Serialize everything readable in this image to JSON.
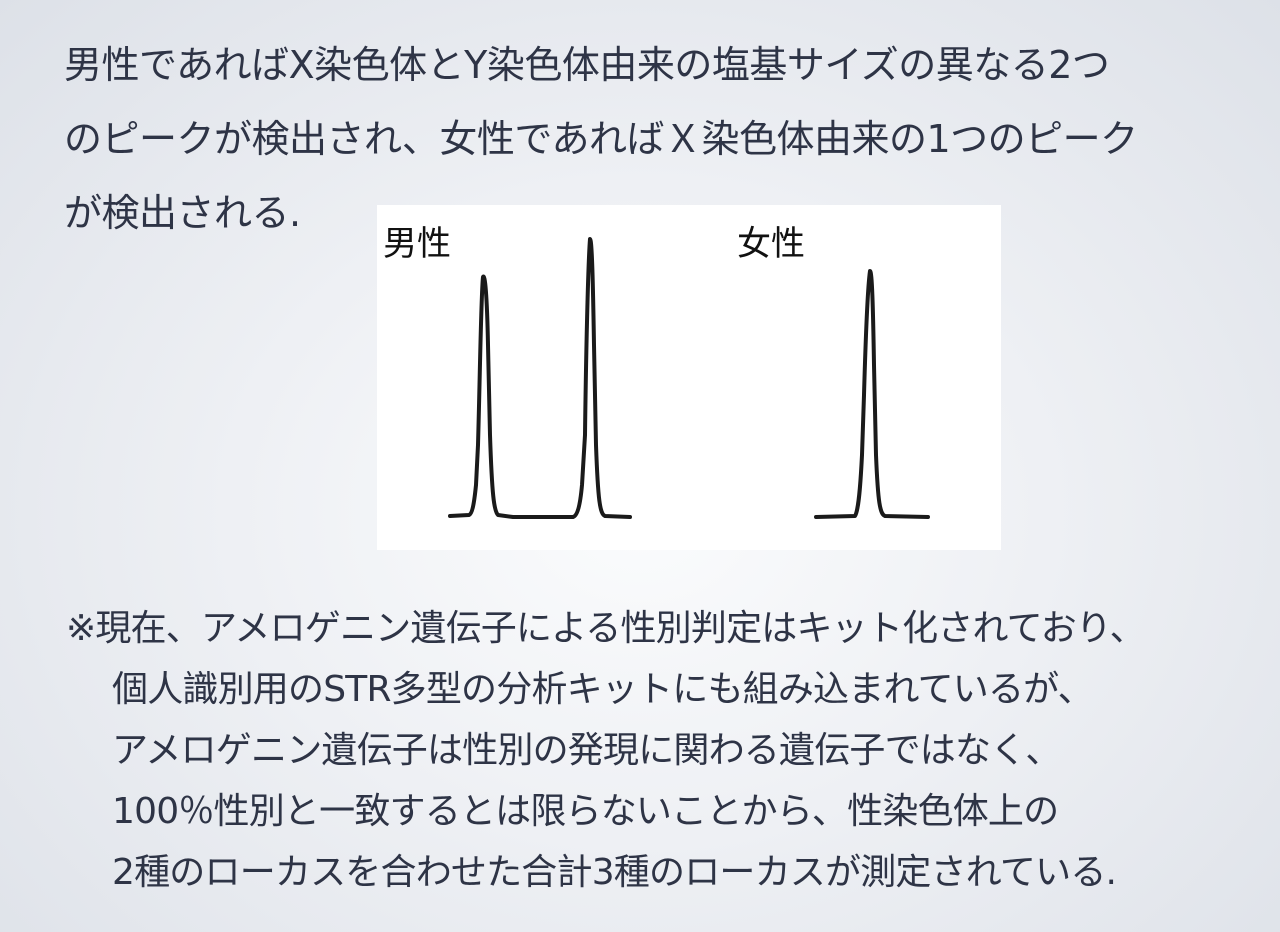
{
  "intro": {
    "lines": [
      "男性であればX染色体とY染色体由来の塩基サイズの異なる2つ",
      "のピークが検出され、女性であればＸ染色体由来の1つのピーク",
      "が検出される."
    ]
  },
  "figure": {
    "male_label": "男性",
    "female_label": "女性",
    "male_peak_count": 2,
    "female_peak_count": 1
  },
  "note": {
    "lines": [
      "※現在、アメロゲニン遺伝子による性別判定はキット化されており、",
      "個人識別用のSTR多型の分析キットにも組み込まれているが、",
      "アメロゲニン遺伝子は性別の発現に関わる遺伝子ではなく、",
      "100％性別と一致するとは限らないことから、性染色体上の",
      "2種のローカスを合わせた合計3種のローカスが測定されている."
    ]
  }
}
